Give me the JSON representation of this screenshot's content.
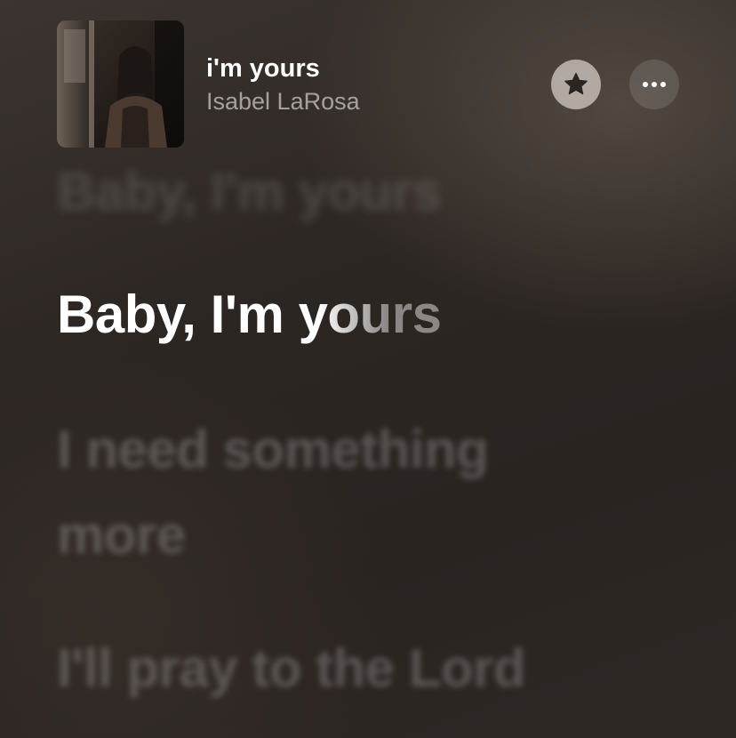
{
  "now_playing": {
    "title": "i'm yours",
    "artist": "Isabel LaRosa",
    "artwork_icon": "album-artwork-image"
  },
  "controls": {
    "favorite_icon": "star-icon",
    "more_icon": "ellipsis-icon"
  },
  "lyrics": {
    "previous_line": "Baby, I'm yours",
    "current_line": "Baby, I'm yours",
    "current_line_progress": 0.8,
    "upcoming_lines": [
      "I need something",
      "more",
      "I'll pray to the Lord"
    ]
  },
  "colors": {
    "background": "#2c2623",
    "active_lyric": "#ffffff",
    "inactive_lyric": "rgba(255,255,255,0.22)",
    "artist_text": "rgba(255,255,255,0.55)"
  }
}
